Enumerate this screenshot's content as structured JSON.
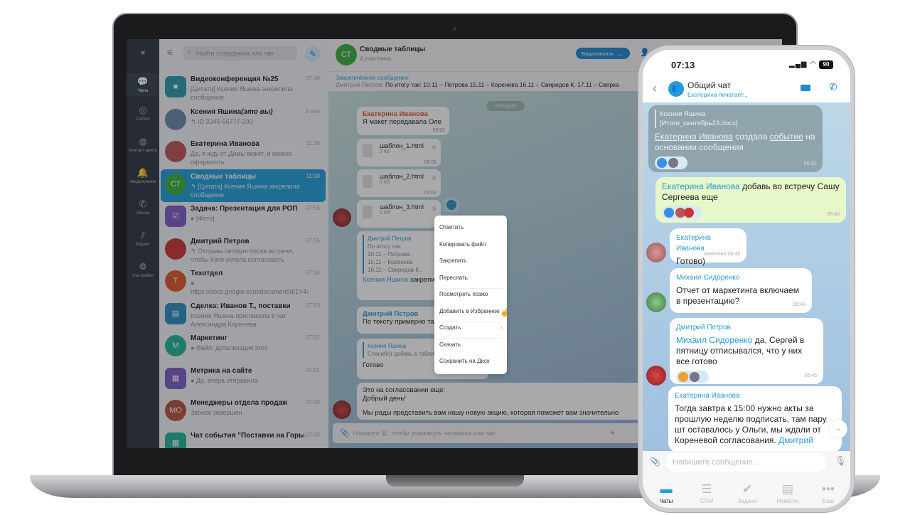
{
  "laptop": {
    "sidebar": {
      "close": "×",
      "items": [
        {
          "icon": "chats-icon",
          "label": "Чаты",
          "active": true
        },
        {
          "icon": "copilot-icon",
          "label": "CoPilot"
        },
        {
          "icon": "contact-center-icon",
          "label": "Контакт-центр"
        },
        {
          "icon": "bell-icon",
          "label": "Уведомления"
        },
        {
          "icon": "phone-icon",
          "label": "Звонки"
        },
        {
          "icon": "market-icon",
          "label": "Маркет"
        },
        {
          "icon": "gear-icon",
          "label": "Настройки"
        }
      ]
    },
    "search": {
      "placeholder": "Найти сотрудника или чат"
    },
    "chats": [
      {
        "title": "Видеоконференция №25",
        "preview": "[Цитата] Ксения Яшина закрепила сообщение.",
        "time": "07:49",
        "avatar": "",
        "color": "#2a9aa6",
        "square": true,
        "icon": "video-icon"
      },
      {
        "title": "Ксения Яшина",
        "title_note": "(это вы)",
        "preview": "↰ ID 3345-66777-200",
        "time": "2 ноя",
        "avatar": "",
        "color": "#6a8aa8"
      },
      {
        "title": "Екатерина Иванова",
        "preview": "Да, я жду от Димы макет, и можно оформлять",
        "time": "11:26",
        "avatar": "",
        "color": "#b55"
      },
      {
        "title": "Сводные таблицы",
        "preview": "↰ [Цитата] Ксения Яшина закрепила сообщение.",
        "time": "11:00",
        "avatar": "СТ",
        "color": "#3aae3f",
        "selected": true
      },
      {
        "title": "Задача: Презентация для РОП",
        "preview": "● [Фото]",
        "time": "07:56",
        "avatar": "",
        "color": "#7b5cc4",
        "square": true,
        "icon": "task-icon"
      },
      {
        "title": "Дмитрий Петров",
        "preview": "↰ Отправь сегодня после встречи, чтобы Катя успела согласовать",
        "time": "07:55",
        "avatar": "",
        "color": "#c33"
      },
      {
        "title": "Техотдел",
        "preview": "● https://docs.google.com/document/d/1Y44MI5vXI9HzKyC7JtPnrgcZ-...",
        "time": "07:54",
        "avatar": "Т",
        "color": "#e0572a"
      },
      {
        "title": "Сделка: Иванов Т., поставки",
        "preview": "Ксения Яшина пригласила в чат Александра Коренева",
        "time": "07:53",
        "avatar": "",
        "color": "#2a8fc4",
        "square": true,
        "icon": "deal-icon"
      },
      {
        "title": "Маркетинг",
        "preview": "● Файл: детализация.html",
        "time": "07:52",
        "avatar": "М",
        "color": "#1fb59a"
      },
      {
        "title": "Метрика на сайте",
        "preview": "● Да, вчера отправила",
        "time": "07:51",
        "avatar": "",
        "color": "#7b5cc4",
        "square": true,
        "icon": "calendar-icon"
      },
      {
        "title": "Менеджеры отдела продаж",
        "preview": "Звонок завершен",
        "time": "07:50",
        "avatar": "МО",
        "color": "#b5523f"
      },
      {
        "title": "Чат события \"Поставки на Горько...",
        "preview": "",
        "time": "07:50",
        "avatar": "",
        "color": "#1fb59a",
        "square": true,
        "icon": "calendar-icon"
      }
    ],
    "chat": {
      "title": "Сводные таблицы",
      "subtitle": "4 участника",
      "avatar": "СТ",
      "video_button": "Видеозвонок",
      "pinned_label": "Закреплённое сообщение",
      "pinned_author": "Дмитрий Петров:",
      "pinned_text": "По итогу так: 10.11 – Петрова 15.11 – Коренева 16.11 – Свиридов К. 17.11 – Сверка",
      "date_divider": "сегодня",
      "msg1": {
        "author": "Екатерина Иванова",
        "text": "Я макет передавала Оле",
        "time": "09:00"
      },
      "files": [
        {
          "name": "шаблон_1.html",
          "size": "2 Кб",
          "time": "09:05"
        },
        {
          "name": "шаблон_2.html",
          "size": "2 Кб",
          "time": "01:02"
        },
        {
          "name": "шаблон_3.html",
          "size": "2 Кб"
        }
      ],
      "quote1": {
        "author": "Дмитрий Петров",
        "lines": [
          "По итогу так:",
          "10.11 – Петрова",
          "15.11 – Коренева",
          "16.11 – Свиридов К..."
        ],
        "who": "Ксения Яшина",
        "action": "закрепила"
      },
      "msg2": {
        "author": "Дмитрий Петров",
        "text": "По тексту примерно так"
      },
      "msg3": {
        "quote_author": "Ксения Яшина",
        "quote_text": "Спасибо) добавь в таблицу",
        "text": "Готово"
      },
      "msg4": {
        "lines": [
          "Это на согласовании еще:",
          "Добрый день!",
          "",
          "Мы рады представить вам нашу новую акцию, которая поможет вам значительно"
        ]
      },
      "input_placeholder": "Нажмите @, чтобы упомянуть человека или чат"
    },
    "context_menu": [
      "Ответить",
      "Копировать файл",
      "Закрепить",
      "Переслать",
      "Посмотреть позже",
      "Добавить в Избранное",
      "Создать",
      "Скачать",
      "Сохранить на Диск"
    ]
  },
  "phone": {
    "status": {
      "time": "07:13",
      "battery": "90"
    },
    "header": {
      "title": "Общий чат",
      "subtitle": "Екатерина печатает..."
    },
    "messages": [
      {
        "quote_author": "Ксения Яшина",
        "quote_text": "[Итоги_сентябрь23.docx]",
        "link1": "Екатерина Иванова",
        "text1": " создала ",
        "link2": "событие",
        "text2": " на основании сообщения",
        "time": "06:32"
      },
      {
        "mention": "Екатерина Иванова",
        "text": " добавь во встречу Сашу Сергеева еще",
        "time": "06:40"
      },
      {
        "author": "Екатерина Иванова",
        "text": "Готово)",
        "edited": "изменено",
        "time": "06:42"
      },
      {
        "author": "Михаил Сидоренко",
        "text": "Отчет от маркетинга включаем в презентацию?",
        "time": "06:43"
      },
      {
        "author": "Дмитрий Петров",
        "mention": "Михаил Сидоренко",
        "text": " да, Сергей в пятницу отписывался, что у них все готово",
        "time": "06:45"
      },
      {
        "author": "Екатерина Иванова",
        "text": "Тогда завтра к 15:00 нужно акты за прошлую неделю подписать, там пару шт оставалось у Ольги, мы ждали от Кореневой согласования. ",
        "mention": "Дмитрий"
      }
    ],
    "input_placeholder": "Напишите сообщение...",
    "tabs": [
      {
        "label": "Чаты",
        "icon": "chat-bubble-icon",
        "active": true
      },
      {
        "label": "CRM",
        "icon": "funnel-icon"
      },
      {
        "label": "Задачи",
        "icon": "check-circle-icon"
      },
      {
        "label": "Новости",
        "icon": "news-icon"
      },
      {
        "label": "Еще",
        "icon": "more-icon"
      }
    ]
  },
  "colors": {
    "accent": "#1f9fd8",
    "link": "#2a9bd6",
    "own_bubble": "#e6f7c9"
  }
}
